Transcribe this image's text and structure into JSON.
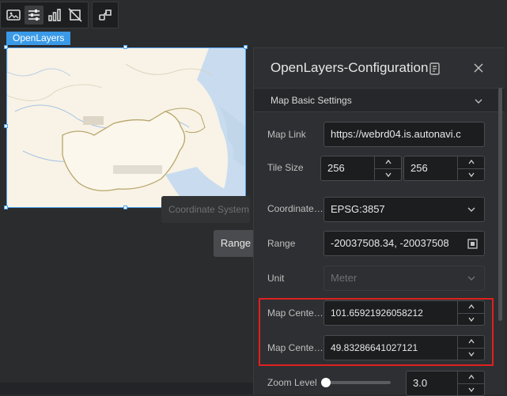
{
  "toolbar": {
    "icons": [
      "image-icon",
      "sliders-icon",
      "bar-chart-icon",
      "crop-icon",
      "style-icon"
    ]
  },
  "map": {
    "tag_label": "OpenLayers"
  },
  "tooltips": {
    "ghost": "Coordinate System",
    "range": "Range"
  },
  "panel": {
    "title": "OpenLayers-Configuration",
    "section_title": "Map Basic Settings",
    "map_link": {
      "label": "Map Link",
      "value": "https://webrd04.is.autonavi.c"
    },
    "tile_size": {
      "label": "Tile Size",
      "width": "256",
      "height": "256"
    },
    "coordinate": {
      "label": "Coordinate System",
      "value": "EPSG:3857"
    },
    "range": {
      "label": "Range",
      "value": "-20037508.34,   -20037508"
    },
    "unit": {
      "label": "Unit",
      "value": "Meter"
    },
    "center_x": {
      "label": "Map Center X",
      "value": "101.65921926058212"
    },
    "center_y": {
      "label": "Map Center Y",
      "value": "49.83286641027121"
    },
    "zoom": {
      "label": "Zoom Level",
      "value": "3.0",
      "slider_fraction": 0.0
    }
  },
  "colors": {
    "accent": "#3a9ae8",
    "highlight": "#e02020",
    "panel_bg": "#2e2f32"
  }
}
